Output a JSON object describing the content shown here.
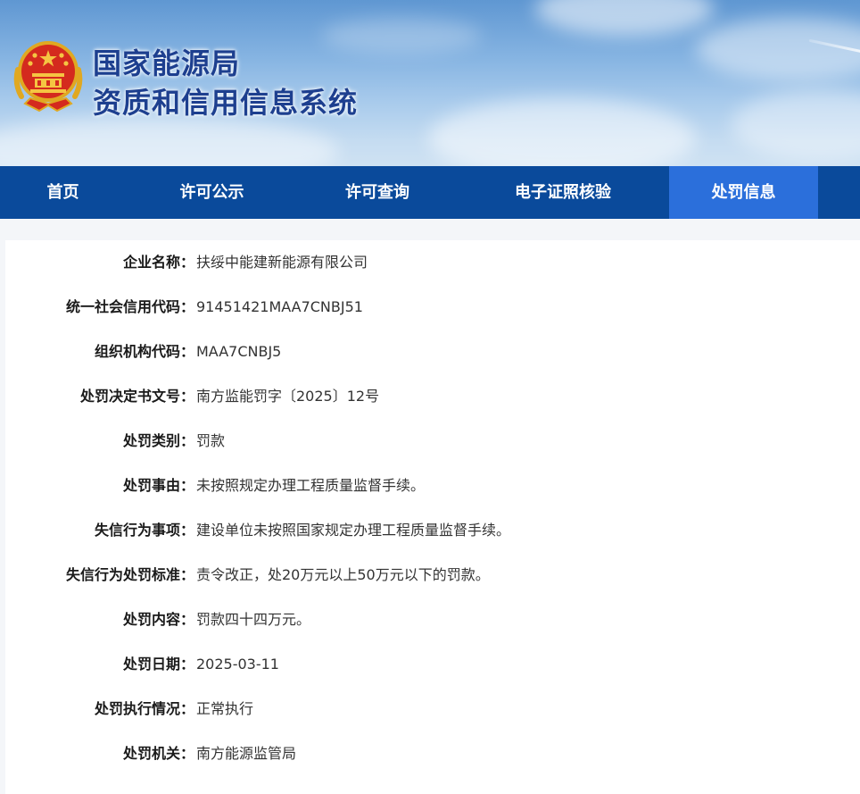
{
  "header": {
    "title_line1": "国家能源局",
    "title_line2": "资质和信用信息系统",
    "emblem_icon": "national-emblem-icon",
    "colors": {
      "title": "#1d3f8f",
      "sky": "#86b4e2"
    }
  },
  "nav": {
    "items": [
      {
        "label": "首页"
      },
      {
        "label": "许可公示"
      },
      {
        "label": "许可查询"
      },
      {
        "label": "电子证照核验"
      },
      {
        "label": "处罚信息"
      }
    ],
    "active_index": 4,
    "colors": {
      "background": "#0a4a9b",
      "active": "#2b6fdb"
    }
  },
  "record": {
    "fields": [
      {
        "label": "企业名称：",
        "value": "扶绥中能建新能源有限公司"
      },
      {
        "label": "统一社会信用代码：",
        "value": "91451421MAA7CNBJ51"
      },
      {
        "label": "组织机构代码：",
        "value": "MAA7CNBJ5"
      },
      {
        "label": "处罚决定书文号：",
        "value": "南方监能罚字〔2025〕12号"
      },
      {
        "label": "处罚类别：",
        "value": "罚款"
      },
      {
        "label": "处罚事由：",
        "value": "未按照规定办理工程质量监督手续。"
      },
      {
        "label": "失信行为事项：",
        "value": "建设单位未按照国家规定办理工程质量监督手续。"
      },
      {
        "label": "失信行为处罚标准：",
        "value": "责令改正，处20万元以上50万元以下的罚款。"
      },
      {
        "label": "处罚内容：",
        "value": "罚款四十四万元。"
      },
      {
        "label": "处罚日期：",
        "value": "2025-03-11"
      },
      {
        "label": "处罚执行情况：",
        "value": "正常执行"
      },
      {
        "label": "处罚机关：",
        "value": "南方能源监管局"
      }
    ]
  }
}
